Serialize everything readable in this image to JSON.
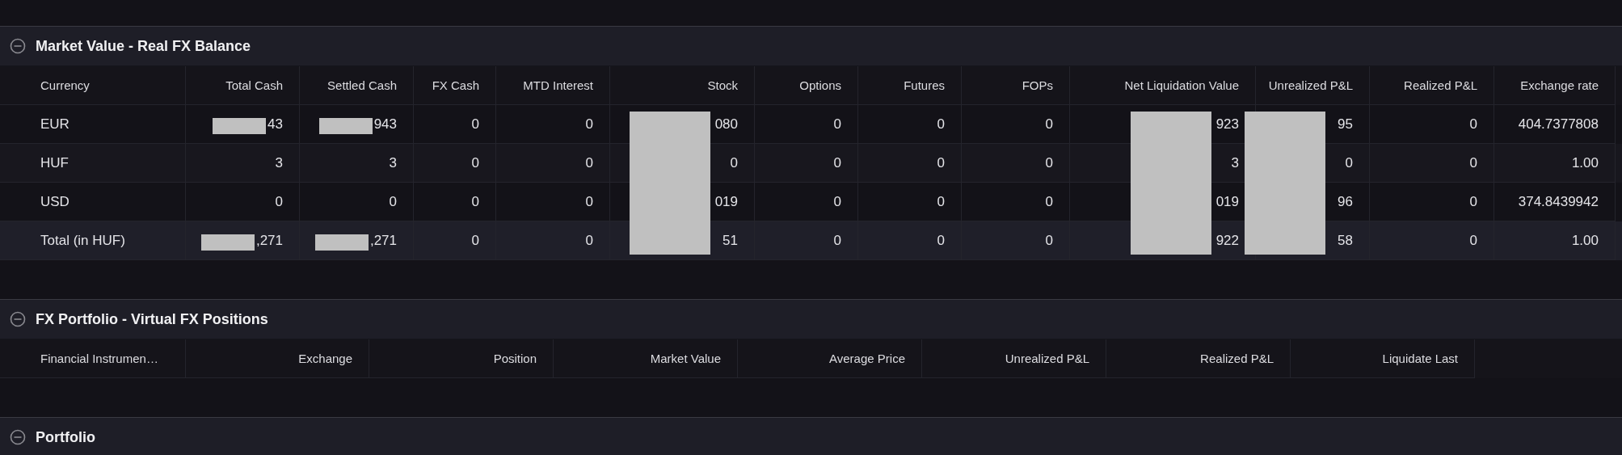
{
  "sections": [
    {
      "title": "Market Value - Real FX Balance",
      "expanded": true,
      "columns": [
        "Currency",
        "Total Cash",
        "Settled Cash",
        "FX Cash",
        "MTD Interest",
        "Stock",
        "Options",
        "Futures",
        "FOPs",
        "Net Liquidation Value",
        "Unrealized P&L",
        "Realized P&L",
        "Exchange rate"
      ],
      "rows": [
        {
          "kind": "currency",
          "cells": [
            "EUR",
            {
              "text": "43",
              "redacted": true
            },
            {
              "text": "943",
              "redacted": true
            },
            "0",
            "0",
            {
              "text": "080",
              "redacted": true
            },
            "0",
            "0",
            "0",
            {
              "text": "923",
              "redacted": true
            },
            {
              "text": "95",
              "redacted": true
            },
            "0",
            "404.7377808"
          ]
        },
        {
          "kind": "currency",
          "cells": [
            "HUF",
            "3",
            "3",
            "0",
            "0",
            {
              "text": "0",
              "redacted": true
            },
            "0",
            "0",
            "0",
            {
              "text": "3",
              "redacted": true
            },
            {
              "text": "0",
              "redacted": true
            },
            "0",
            "1.00"
          ]
        },
        {
          "kind": "currency",
          "cells": [
            "USD",
            "0",
            "0",
            "0",
            "0",
            {
              "text": "019",
              "redacted": true
            },
            "0",
            "0",
            "0",
            {
              "text": "019",
              "redacted": true
            },
            {
              "text": "96",
              "redacted": true
            },
            "0",
            "374.8439942"
          ]
        },
        {
          "kind": "total",
          "cells": [
            "Total (in HUF)",
            {
              "text": ",271",
              "redacted": true
            },
            {
              "text": ",271",
              "redacted": true
            },
            "0",
            "0",
            {
              "text": "51",
              "redacted": true
            },
            "0",
            "0",
            "0",
            {
              "text": "922",
              "redacted": true
            },
            {
              "text": "58",
              "redacted": true
            },
            "0",
            "1.00"
          ]
        }
      ]
    },
    {
      "title": "FX Portfolio - Virtual FX Positions",
      "expanded": true,
      "columns": [
        "Financial Instrumen…",
        "Exchange",
        "Position",
        "Market Value",
        "Average Price",
        "Unrealized P&L",
        "Realized P&L",
        "Liquidate Last"
      ]
    },
    {
      "title": "Portfolio",
      "expanded": true
    }
  ]
}
